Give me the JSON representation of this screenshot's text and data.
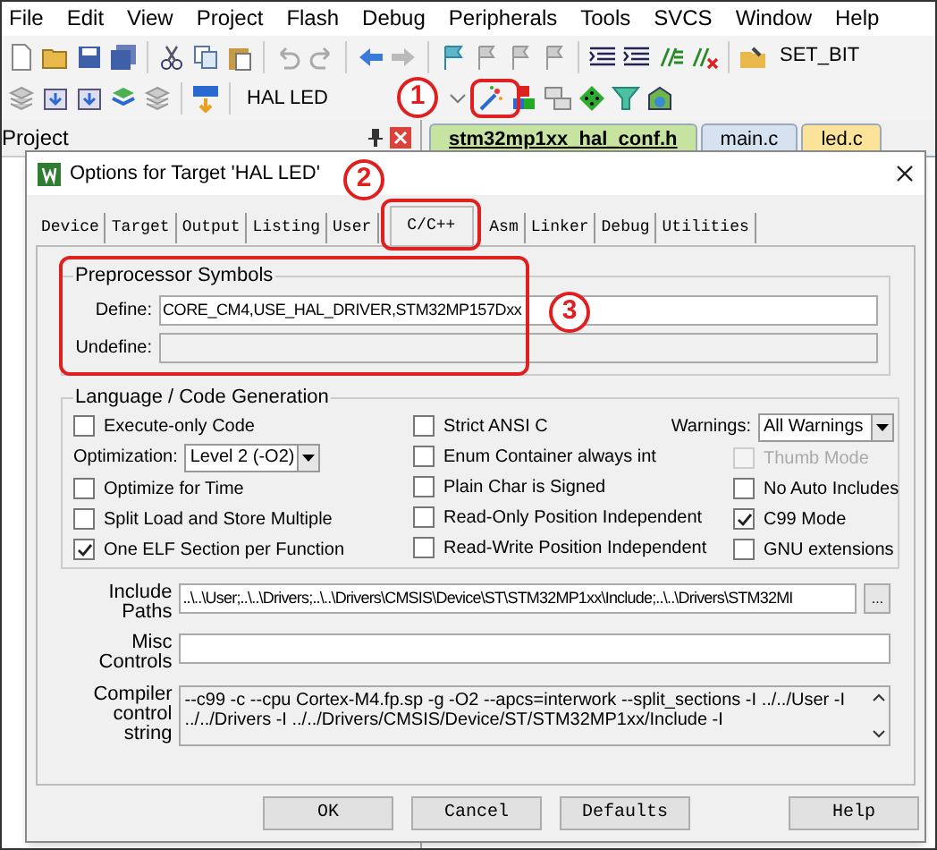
{
  "menu": [
    "File",
    "Edit",
    "View",
    "Project",
    "Flash",
    "Debug",
    "Peripherals",
    "Tools",
    "SVCS",
    "Window",
    "Help"
  ],
  "toolbar": {
    "macro": "SET_BIT",
    "target": "HAL LED"
  },
  "project_panel": {
    "title": "Project"
  },
  "editor_tabs": [
    {
      "label": "stm32mp1xx_hal_conf.h",
      "selected": true,
      "color": "#c6e3a0"
    },
    {
      "label": "main.c",
      "selected": false,
      "color": "#d6e2f0"
    },
    {
      "label": "led.c",
      "selected": false,
      "color": "#fbe49a"
    }
  ],
  "dialog": {
    "title": "Options for Target 'HAL LED'",
    "tabs": [
      {
        "label": "Device",
        "selected": false
      },
      {
        "label": "Target",
        "selected": false
      },
      {
        "label": "Output",
        "selected": false
      },
      {
        "label": "Listing",
        "selected": false
      },
      {
        "label": "User",
        "selected": false
      },
      {
        "label": "C/C++",
        "selected": true
      },
      {
        "label": "Asm",
        "selected": false
      },
      {
        "label": "Linker",
        "selected": false
      },
      {
        "label": "Debug",
        "selected": false
      },
      {
        "label": "Utilities",
        "selected": false
      }
    ],
    "preprocessor": {
      "title": "Preprocessor Symbols",
      "define_label": "Define:",
      "define": "CORE_CM4,USE_HAL_DRIVER,STM32MP157Dxx",
      "undefine_label": "Undefine:"
    },
    "codegen": {
      "title": "Language / Code Generation",
      "columns": [
        [
          {
            "kind": "checkbox",
            "label": "Execute-only Code",
            "checked": false,
            "disabled": false
          },
          {
            "kind": "select",
            "label": "Optimization:",
            "value": "Level 2 (-O2)"
          },
          {
            "kind": "checkbox",
            "label": "Optimize for Time",
            "checked": false,
            "disabled": false
          },
          {
            "kind": "checkbox",
            "label": "Split Load and Store Multiple",
            "checked": false,
            "disabled": false
          },
          {
            "kind": "checkbox",
            "label": "One ELF Section per Function",
            "checked": true,
            "disabled": false
          }
        ],
        [
          {
            "kind": "checkbox",
            "label": "Strict ANSI C",
            "checked": false,
            "disabled": false
          },
          {
            "kind": "checkbox",
            "label": "Enum Container always int",
            "checked": false,
            "disabled": false
          },
          {
            "kind": "checkbox",
            "label": "Plain Char is Signed",
            "checked": false,
            "disabled": false
          },
          {
            "kind": "checkbox",
            "label": "Read-Only Position Independent",
            "checked": false,
            "disabled": false
          },
          {
            "kind": "checkbox",
            "label": "Read-Write Position Independent",
            "checked": false,
            "disabled": false
          }
        ],
        [
          {
            "kind": "select",
            "label": "Warnings:",
            "value": "All Warnings"
          },
          {
            "kind": "checkbox",
            "label": "Thumb Mode",
            "checked": false,
            "disabled": true
          },
          {
            "kind": "checkbox",
            "label": "No Auto Includes",
            "checked": false,
            "disabled": false
          },
          {
            "kind": "checkbox",
            "label": "C99 Mode",
            "checked": true,
            "disabled": false
          },
          {
            "kind": "checkbox",
            "label": "GNU extensions",
            "checked": false,
            "disabled": false
          }
        ]
      ]
    },
    "include_paths": {
      "label": "Include Paths",
      "value": "..\\..\\User;..\\..\\Drivers;..\\..\\Drivers\\CMSIS\\Device\\ST\\STM32MP1xx\\Include;..\\..\\Drivers\\STM32MI",
      "browse": "..."
    },
    "misc_controls": {
      "label": "Misc Controls"
    },
    "compiler_string": {
      "label": "Compiler control string",
      "value": "--c99 -c --cpu Cortex-M4.fp.sp -g -O2 --apcs=interwork --split_sections -I ../../User -I ../../Drivers -I ../../Drivers/CMSIS/Device/ST/STM32MP1xx/Include -I"
    },
    "buttons": [
      "OK",
      "Cancel",
      "Defaults",
      "Help"
    ]
  },
  "callouts": [
    "1",
    "2",
    "3"
  ]
}
